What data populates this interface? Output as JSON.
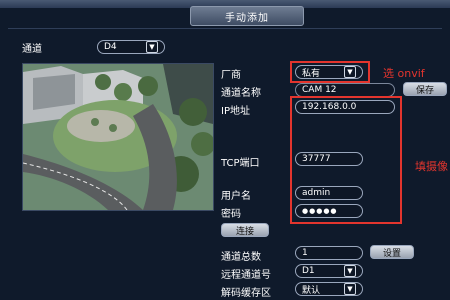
{
  "dialog": {
    "title": "手动添加"
  },
  "channel": {
    "label": "通道",
    "value": "D4"
  },
  "form": {
    "vendor": {
      "label": "厂商",
      "value": "私有"
    },
    "channel_name": {
      "label": "通道名称",
      "value": "CAM 12",
      "save_button": "保存"
    },
    "ip": {
      "label": "IP地址",
      "value": "192.168.0.0"
    },
    "tcp_port": {
      "label": "TCP端口",
      "value": "37777"
    },
    "username": {
      "label": "用户名",
      "value": "admin"
    },
    "password": {
      "label": "密码",
      "value": "●●●●●"
    },
    "connect_button": "连接"
  },
  "bottom": {
    "total_channels": {
      "label": "通道总数",
      "value": "1",
      "button": "设置"
    },
    "remote_channel": {
      "label": "远程通道号",
      "value": "D1"
    },
    "decode_buffer": {
      "label": "解码缓存区",
      "value": "默认"
    }
  },
  "annotations": {
    "select_onvif": "选 onvif",
    "fill_hint": "填摄像"
  },
  "colors": {
    "background": "#0f1a2b",
    "annotation_red": "#e3352e",
    "field_border": "#9aa7bd"
  }
}
